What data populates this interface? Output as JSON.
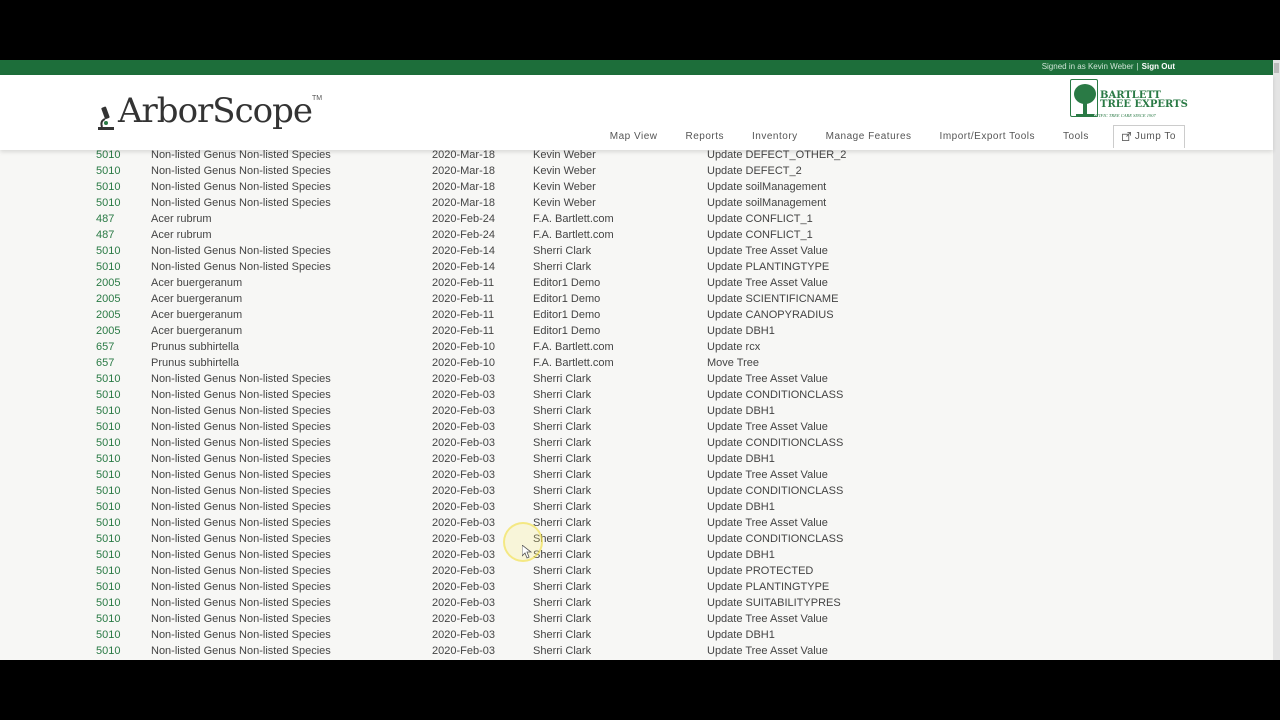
{
  "top_bar": {
    "signed_in_text": "Signed in as Kevin Weber",
    "separator": "|",
    "sign_out": "Sign Out"
  },
  "brand": {
    "logo_text": "ArborScope",
    "logo_tm": "TM",
    "partner_name_line1": "BARTLETT",
    "partner_name_line2": "TREE EXPERTS",
    "partner_tagline": "SCIENTIFIC TREE CARE SINCE 1907"
  },
  "nav": {
    "items": [
      "Map View",
      "Reports",
      "Inventory",
      "Manage Features",
      "Import/Export Tools",
      "Tools"
    ],
    "jump_to": "Jump To"
  },
  "colors": {
    "accent_green": "#1d6e3a",
    "link_green": "#2a7a45"
  },
  "rows": [
    [
      "5010",
      "Non-listed Genus Non-listed Species",
      "2020-Mar-18",
      "Kevin Weber",
      "Update DEFECT_OTHER_2"
    ],
    [
      "5010",
      "Non-listed Genus Non-listed Species",
      "2020-Mar-18",
      "Kevin Weber",
      "Update DEFECT_2"
    ],
    [
      "5010",
      "Non-listed Genus Non-listed Species",
      "2020-Mar-18",
      "Kevin Weber",
      "Update soilManagement"
    ],
    [
      "5010",
      "Non-listed Genus Non-listed Species",
      "2020-Mar-18",
      "Kevin Weber",
      "Update soilManagement"
    ],
    [
      "487",
      "Acer rubrum",
      "2020-Feb-24",
      "F.A. Bartlett.com",
      "Update CONFLICT_1"
    ],
    [
      "487",
      "Acer rubrum",
      "2020-Feb-24",
      "F.A. Bartlett.com",
      "Update CONFLICT_1"
    ],
    [
      "5010",
      "Non-listed Genus Non-listed Species",
      "2020-Feb-14",
      "Sherri Clark",
      "Update Tree Asset Value"
    ],
    [
      "5010",
      "Non-listed Genus Non-listed Species",
      "2020-Feb-14",
      "Sherri Clark",
      "Update PLANTINGTYPE"
    ],
    [
      "2005",
      "Acer buergeranum",
      "2020-Feb-11",
      "Editor1 Demo",
      "Update Tree Asset Value"
    ],
    [
      "2005",
      "Acer buergeranum",
      "2020-Feb-11",
      "Editor1 Demo",
      "Update SCIENTIFICNAME"
    ],
    [
      "2005",
      "Acer buergeranum",
      "2020-Feb-11",
      "Editor1 Demo",
      "Update CANOPYRADIUS"
    ],
    [
      "2005",
      "Acer buergeranum",
      "2020-Feb-11",
      "Editor1 Demo",
      "Update DBH1"
    ],
    [
      "657",
      "Prunus subhirtella",
      "2020-Feb-10",
      "F.A. Bartlett.com",
      "Update rcx"
    ],
    [
      "657",
      "Prunus subhirtella",
      "2020-Feb-10",
      "F.A. Bartlett.com",
      "Move Tree"
    ],
    [
      "5010",
      "Non-listed Genus Non-listed Species",
      "2020-Feb-03",
      "Sherri Clark",
      "Update Tree Asset Value"
    ],
    [
      "5010",
      "Non-listed Genus Non-listed Species",
      "2020-Feb-03",
      "Sherri Clark",
      "Update CONDITIONCLASS"
    ],
    [
      "5010",
      "Non-listed Genus Non-listed Species",
      "2020-Feb-03",
      "Sherri Clark",
      "Update DBH1"
    ],
    [
      "5010",
      "Non-listed Genus Non-listed Species",
      "2020-Feb-03",
      "Sherri Clark",
      "Update Tree Asset Value"
    ],
    [
      "5010",
      "Non-listed Genus Non-listed Species",
      "2020-Feb-03",
      "Sherri Clark",
      "Update CONDITIONCLASS"
    ],
    [
      "5010",
      "Non-listed Genus Non-listed Species",
      "2020-Feb-03",
      "Sherri Clark",
      "Update DBH1"
    ],
    [
      "5010",
      "Non-listed Genus Non-listed Species",
      "2020-Feb-03",
      "Sherri Clark",
      "Update Tree Asset Value"
    ],
    [
      "5010",
      "Non-listed Genus Non-listed Species",
      "2020-Feb-03",
      "Sherri Clark",
      "Update CONDITIONCLASS"
    ],
    [
      "5010",
      "Non-listed Genus Non-listed Species",
      "2020-Feb-03",
      "Sherri Clark",
      "Update DBH1"
    ],
    [
      "5010",
      "Non-listed Genus Non-listed Species",
      "2020-Feb-03",
      "Sherri Clark",
      "Update Tree Asset Value"
    ],
    [
      "5010",
      "Non-listed Genus Non-listed Species",
      "2020-Feb-03",
      "Sherri Clark",
      "Update CONDITIONCLASS"
    ],
    [
      "5010",
      "Non-listed Genus Non-listed Species",
      "2020-Feb-03",
      "Sherri Clark",
      "Update DBH1"
    ],
    [
      "5010",
      "Non-listed Genus Non-listed Species",
      "2020-Feb-03",
      "Sherri Clark",
      "Update PROTECTED"
    ],
    [
      "5010",
      "Non-listed Genus Non-listed Species",
      "2020-Feb-03",
      "Sherri Clark",
      "Update PLANTINGTYPE"
    ],
    [
      "5010",
      "Non-listed Genus Non-listed Species",
      "2020-Feb-03",
      "Sherri Clark",
      "Update SUITABILITYPRES"
    ],
    [
      "5010",
      "Non-listed Genus Non-listed Species",
      "2020-Feb-03",
      "Sherri Clark",
      "Update Tree Asset Value"
    ],
    [
      "5010",
      "Non-listed Genus Non-listed Species",
      "2020-Feb-03",
      "Sherri Clark",
      "Update DBH1"
    ],
    [
      "5010",
      "Non-listed Genus Non-listed Species",
      "2020-Feb-03",
      "Sherri Clark",
      "Update Tree Asset Value"
    ]
  ]
}
